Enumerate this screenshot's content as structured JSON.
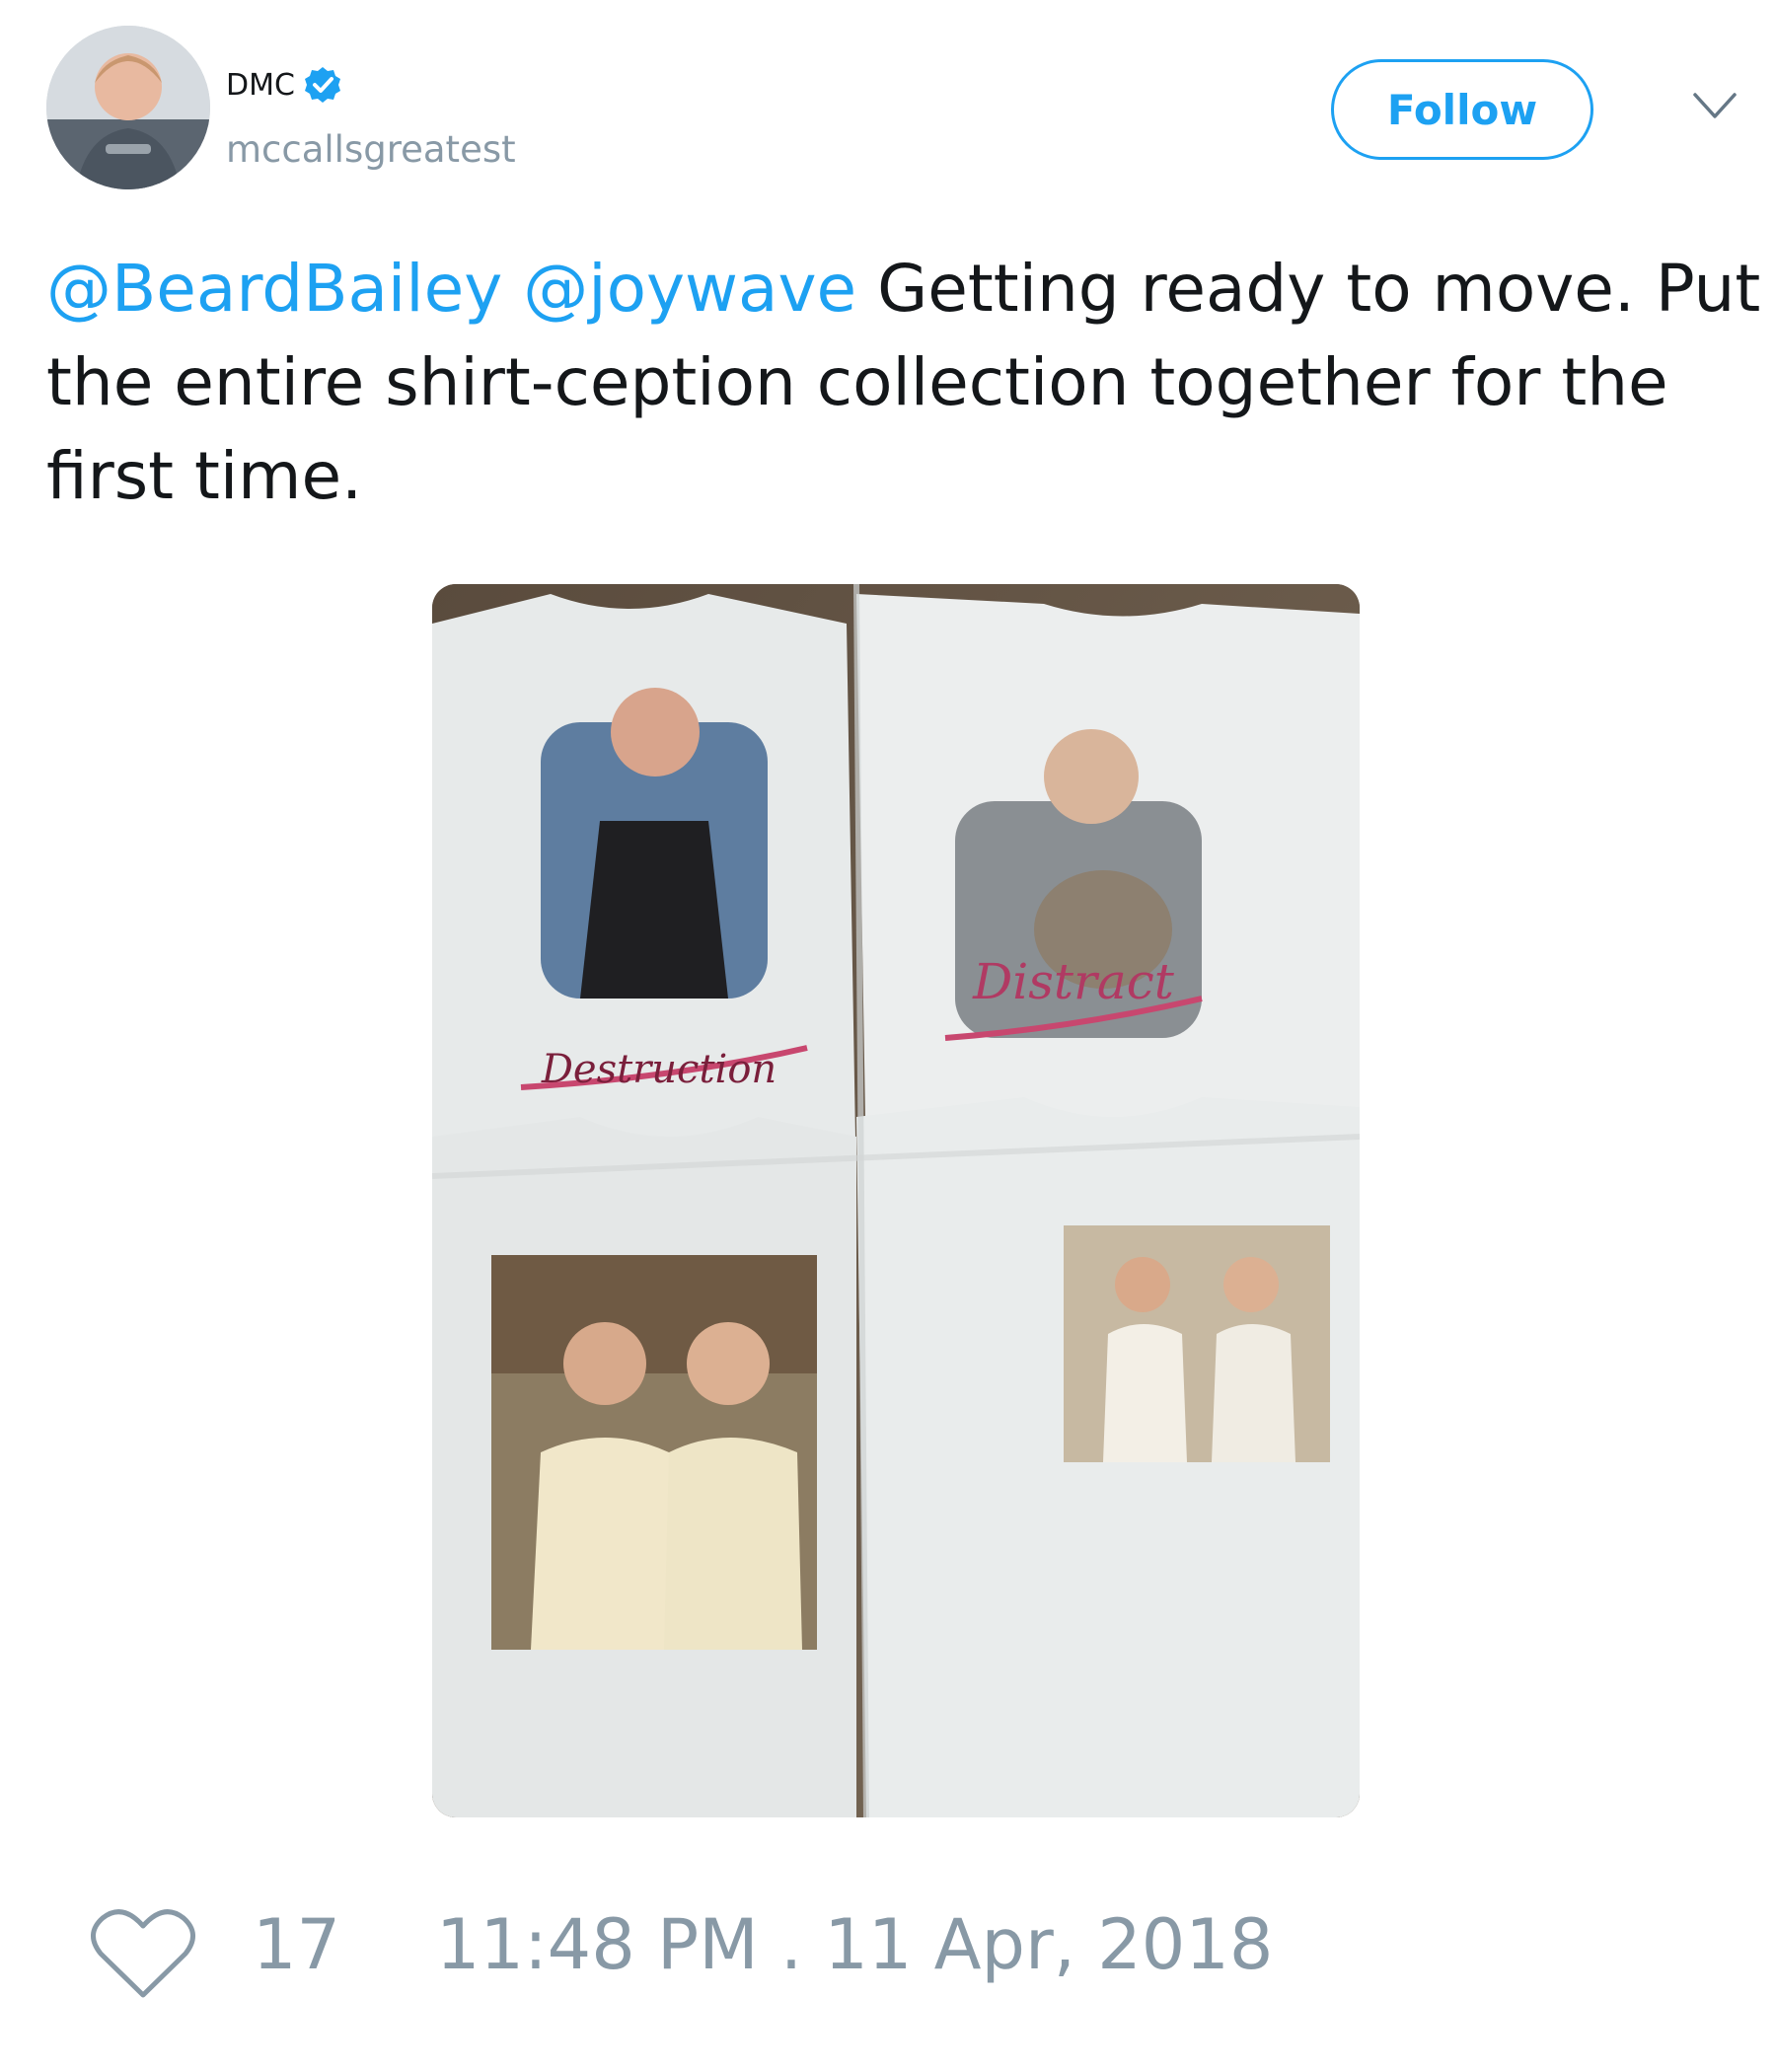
{
  "tweet": {
    "author": {
      "display_name": "DMC",
      "handle": "mccallsgreatest",
      "verified": true,
      "avatar_icon": "profile-photo"
    },
    "follow_label": "Follow",
    "menu_icon": "chevron-down-icon",
    "text": {
      "mention_1": "@BeardBailey",
      "mention_2": "@joywave",
      "body": "Getting ready to move. Put the entire shirt-ception collection together for the first time."
    },
    "media": {
      "shirt_labels": [
        "Destruction",
        "Distract"
      ]
    },
    "likes": "17",
    "timestamp": "11:48 PM . 11 Apr, 2018"
  },
  "colors": {
    "accent": "#1da1f2",
    "text": "#14171a",
    "muted": "#8899a6"
  }
}
